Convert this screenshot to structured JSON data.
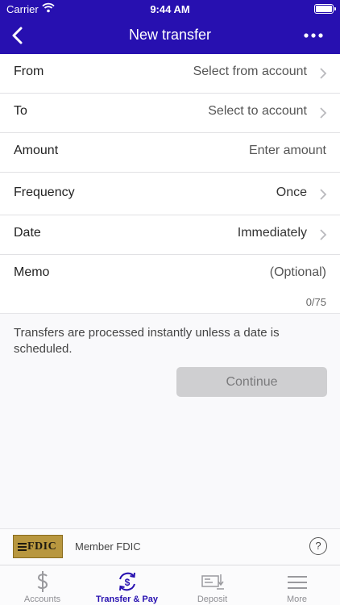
{
  "status_bar": {
    "carrier": "Carrier",
    "time": "9:44 AM"
  },
  "header": {
    "title": "New transfer",
    "back_icon": "chevron-left-icon",
    "menu_icon": "more-dots-icon"
  },
  "form": {
    "from": {
      "label": "From",
      "value": "Select from account"
    },
    "to": {
      "label": "To",
      "value": "Select to account"
    },
    "amount": {
      "label": "Amount",
      "placeholder": "Enter amount"
    },
    "frequency": {
      "label": "Frequency",
      "value": "Once"
    },
    "date": {
      "label": "Date",
      "value": "Immediately"
    },
    "memo": {
      "label": "Memo",
      "placeholder": "(Optional)",
      "counter": "0/75"
    }
  },
  "info": {
    "text": "Transfers are processed instantly unless a date is scheduled."
  },
  "continue_label": "Continue",
  "fdic": {
    "logo_text": "FDIC",
    "member_text": "Member FDIC",
    "help": "?"
  },
  "tabs": [
    {
      "label": "Accounts",
      "icon": "dollar-icon"
    },
    {
      "label": "Transfer & Pay",
      "icon": "transfer-icon",
      "active": true
    },
    {
      "label": "Deposit",
      "icon": "deposit-check-icon"
    },
    {
      "label": "More",
      "icon": "menu-icon"
    }
  ],
  "colors": {
    "brand": "#2710b0",
    "tab_inactive": "#8e8e93",
    "button_disabled": "#cfcfd1"
  }
}
